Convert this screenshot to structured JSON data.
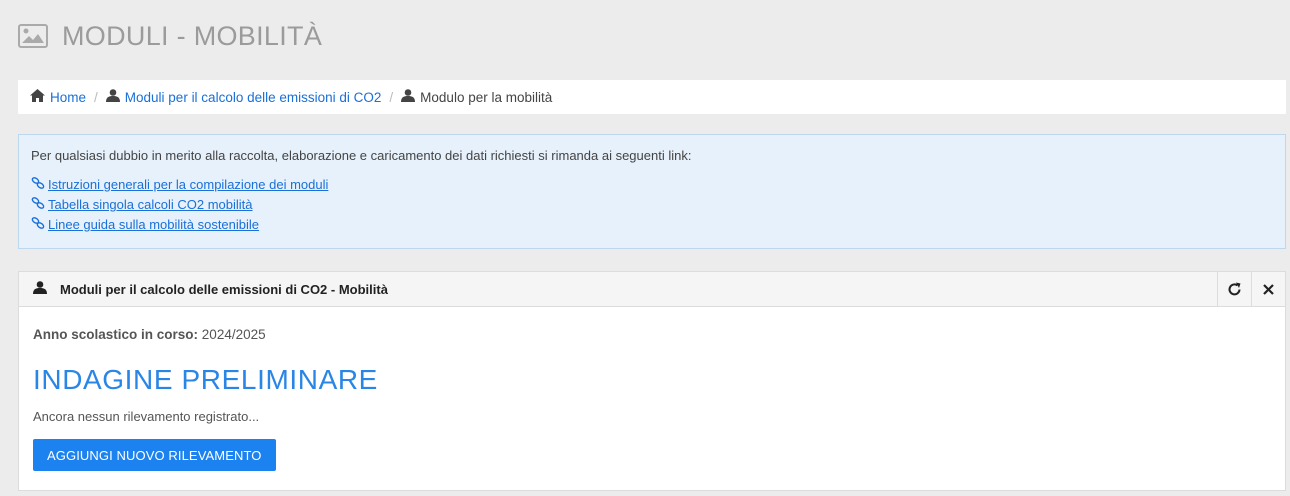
{
  "header": {
    "title": "MODULI - MOBILITÀ",
    "icon": "image-icon"
  },
  "breadcrumb": {
    "items": [
      {
        "label": "Home",
        "icon": "home-icon"
      },
      {
        "label": "Moduli per il calcolo delle emissioni di CO2",
        "icon": "user-icon"
      },
      {
        "label": "Modulo per la mobilità",
        "icon": "user-icon"
      }
    ],
    "separator": "/"
  },
  "info": {
    "intro": "Per qualsiasi dubbio in merito alla raccolta, elaborazione e caricamento dei dati richiesti si rimanda ai seguenti link:",
    "links": [
      {
        "label": "Istruzioni generali per la compilazione dei moduli",
        "icon": "link-icon"
      },
      {
        "label": "Tabella singola calcoli CO2 mobilità",
        "icon": "link-icon"
      },
      {
        "label": "Linee guida sulla mobilità sostenibile",
        "icon": "link-icon"
      }
    ]
  },
  "panel": {
    "title": "Moduli per il calcolo delle emissioni di CO2 - Mobilità",
    "reload_icon": "refresh-icon",
    "close_icon": "close-icon",
    "year_label": "Anno scolastico in corso:",
    "year_value": "2024/2025",
    "survey_title": "INDAGINE PRELIMINARE",
    "empty_text": "Ancora nessun rilevamento registrato...",
    "add_button": "AGGIUNGI NUOVO RILEVAMENTO"
  },
  "colors": {
    "link": "#1a6fd8",
    "accent": "#2a86e6",
    "button": "#1b82ef",
    "info_bg": "#e6f1fb"
  }
}
